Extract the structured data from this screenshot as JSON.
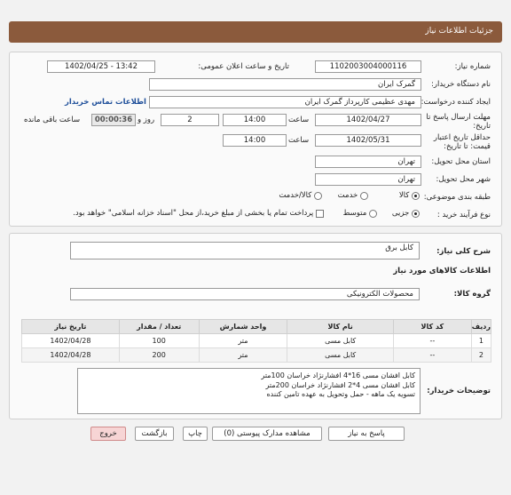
{
  "header": {
    "title": "جزئیات اطلاعات نیاز"
  },
  "fields": {
    "need_number_label": "شماره نیاز:",
    "need_number": "1102003004000116",
    "announce_label": "تاریخ و ساعت اعلان عمومی:",
    "announce_value": "1402/04/25 - 13:42",
    "buyer_org_label": "نام دستگاه خریدار:",
    "buyer_org": "گمرک ایران",
    "creator_label": "ایجاد کننده درخواست:",
    "creator": "مهدی عظیمی کارپرداز گمرک ایران",
    "contact_link": "اطلاعات تماس خریدار",
    "deadline_label": "مهلت ارسال پاسخ تا تاریخ:",
    "deadline_date": "1402/04/27",
    "time_label": "ساعت",
    "deadline_time": "14:00",
    "days_value": "2",
    "days_label": "روز و",
    "remaining_time": "00:00:36",
    "remaining_label": "ساعت باقی مانده",
    "validity_label": "حداقل تاریخ اعتبار قیمت: تا تاریخ:",
    "validity_date": "1402/05/31",
    "validity_time": "14:00",
    "province_label": "استان محل تحویل:",
    "province": "تهران",
    "city_label": "شهر محل تحویل:",
    "city": "تهران",
    "category_label": "طبقه بندی موضوعی:",
    "category_options": [
      "کالا",
      "خدمت",
      "کالا/خدمت"
    ],
    "process_label": "نوع فرآیند خرید :",
    "process_options": [
      "جزیی",
      "متوسط"
    ],
    "payment_note": "پرداخت تمام یا بخشی از مبلغ خرید،از محل \"اسناد خزانه اسلامی\" خواهد بود."
  },
  "summary": {
    "label": "شرح کلی نیاز:",
    "value": "کابل برق"
  },
  "goods_section_title": "اطلاعات کالاهای مورد نیاز",
  "group": {
    "label": "گروه کالا:",
    "value": "محصولات الکترونیکی"
  },
  "table": {
    "headers": [
      "ردیف",
      "کد کالا",
      "نام کالا",
      "واحد شمارش",
      "تعداد / مقدار",
      "تاریخ نیاز"
    ],
    "rows": [
      [
        "1",
        "--",
        "کابل مسی",
        "متر",
        "100",
        "1402/04/28"
      ],
      [
        "2",
        "--",
        "کابل مسی",
        "متر",
        "200",
        "1402/04/28"
      ]
    ]
  },
  "notes": {
    "label": "توضیحات خریدار:",
    "lines": [
      "کابل افشان مسی 16*4 افشارنژاد خراسان 100متر",
      "کابل افشان مسی 4*2 افشارنژاد خراسان 200متر",
      "تسویه یک ماهه - حمل وتحویل به عهده تامین کننده"
    ]
  },
  "buttons": {
    "reply": "پاسخ به نیاز",
    "docs": "مشاهده مدارک پیوستی (0)",
    "print": "چاپ",
    "back": "بازگشت",
    "exit": "خروج"
  }
}
